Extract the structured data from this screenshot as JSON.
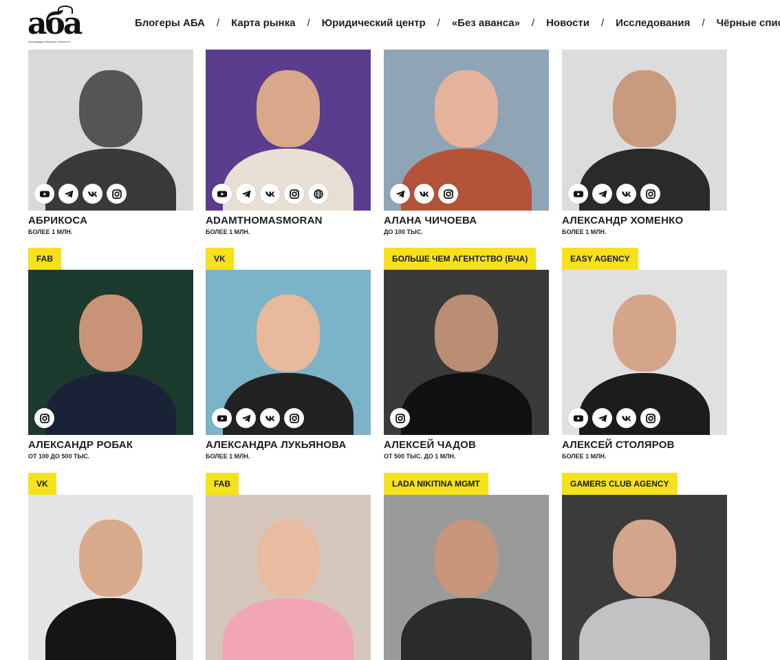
{
  "brand": {
    "logo_text": "аба",
    "logo_subtitle": "Ассоциация блогеров и агентств"
  },
  "nav": {
    "items": [
      {
        "label": "Блогеры АБА"
      },
      {
        "label": "Карта рынка"
      },
      {
        "label": "Юридический центр"
      },
      {
        "label": "«Без аванса»"
      },
      {
        "label": "Новости"
      },
      {
        "label": "Исследования"
      },
      {
        "label": "Чёрные спис"
      }
    ],
    "separator": "/"
  },
  "bloggers": [
    {
      "agency": "",
      "name": "Абрикоса",
      "audience": "Более 1 млн.",
      "socials": [
        "youtube-icon",
        "telegram-icon",
        "vk-icon",
        "instagram-icon"
      ],
      "tone": {
        "bg": "#d9d9d9",
        "fg": "#555555",
        "body": "#3a3a3a"
      }
    },
    {
      "agency": "",
      "name": "adamthomasmoran",
      "audience": "Более 1 млн.",
      "socials": [
        "youtube-icon",
        "telegram-icon",
        "vk-icon",
        "instagram-icon",
        "globe-icon"
      ],
      "tone": {
        "bg": "#5a3d8e",
        "fg": "#d9a88a",
        "body": "#e8e0d5"
      }
    },
    {
      "agency": "",
      "name": "Алана Чичоева",
      "audience": "До 100 тыс.",
      "socials": [
        "telegram-icon",
        "vk-icon",
        "instagram-icon"
      ],
      "tone": {
        "bg": "#8fa4b5",
        "fg": "#e5b39a",
        "body": "#b5523a"
      }
    },
    {
      "agency": "",
      "name": "Александр Хоменко",
      "audience": "Более 1 млн.",
      "socials": [
        "youtube-icon",
        "telegram-icon",
        "vk-icon",
        "instagram-icon"
      ],
      "tone": {
        "bg": "#dcdcdc",
        "fg": "#c89a7e",
        "body": "#2a2a2a"
      }
    },
    {
      "agency": "FAB",
      "name": "Александр Робак",
      "audience": "От 100 до 500 тыс.",
      "socials": [
        "instagram-icon"
      ],
      "tone": {
        "bg": "#1c3a2e",
        "fg": "#c99378",
        "body": "#1a2238"
      }
    },
    {
      "agency": "VK",
      "name": "Александра Лукьянова",
      "audience": "Более 1 млн.",
      "socials": [
        "youtube-icon",
        "telegram-icon",
        "vk-icon",
        "instagram-icon"
      ],
      "tone": {
        "bg": "#7bb3c9",
        "fg": "#e8b99a",
        "body": "#222222"
      }
    },
    {
      "agency": "Больше Чем Агентство (БЧА)",
      "name": "Алексей Чадов",
      "audience": "От 500 тыс. до 1 млн.",
      "socials": [
        "instagram-icon"
      ],
      "tone": {
        "bg": "#3a3a3a",
        "fg": "#b98e75",
        "body": "#111111"
      }
    },
    {
      "agency": "Easy Agency",
      "name": "Алексей Столяров",
      "audience": "Более 1 млн.",
      "socials": [
        "youtube-icon",
        "telegram-icon",
        "vk-icon",
        "instagram-icon"
      ],
      "tone": {
        "bg": "#e0e0e0",
        "fg": "#d4a589",
        "body": "#1c1c1c"
      }
    },
    {
      "agency": "VK",
      "name": "",
      "audience": "",
      "socials": [],
      "tone": {
        "bg": "#e4e4e4",
        "fg": "#d9a98c",
        "body": "#151515"
      }
    },
    {
      "agency": "FAB",
      "name": "",
      "audience": "",
      "socials": [],
      "tone": {
        "bg": "#d6c7bd",
        "fg": "#e9bca1",
        "body": "#f2a6b5"
      }
    },
    {
      "agency": "Lada Nikitina MGMT",
      "name": "",
      "audience": "",
      "socials": [],
      "tone": {
        "bg": "#9a9a9a",
        "fg": "#c9967b",
        "body": "#2b2b2b"
      }
    },
    {
      "agency": "Gamers Club Agency",
      "name": "",
      "audience": "",
      "socials": [],
      "tone": {
        "bg": "#3b3b3b",
        "fg": "#d2a58c",
        "body": "#c2c2c2"
      }
    }
  ]
}
